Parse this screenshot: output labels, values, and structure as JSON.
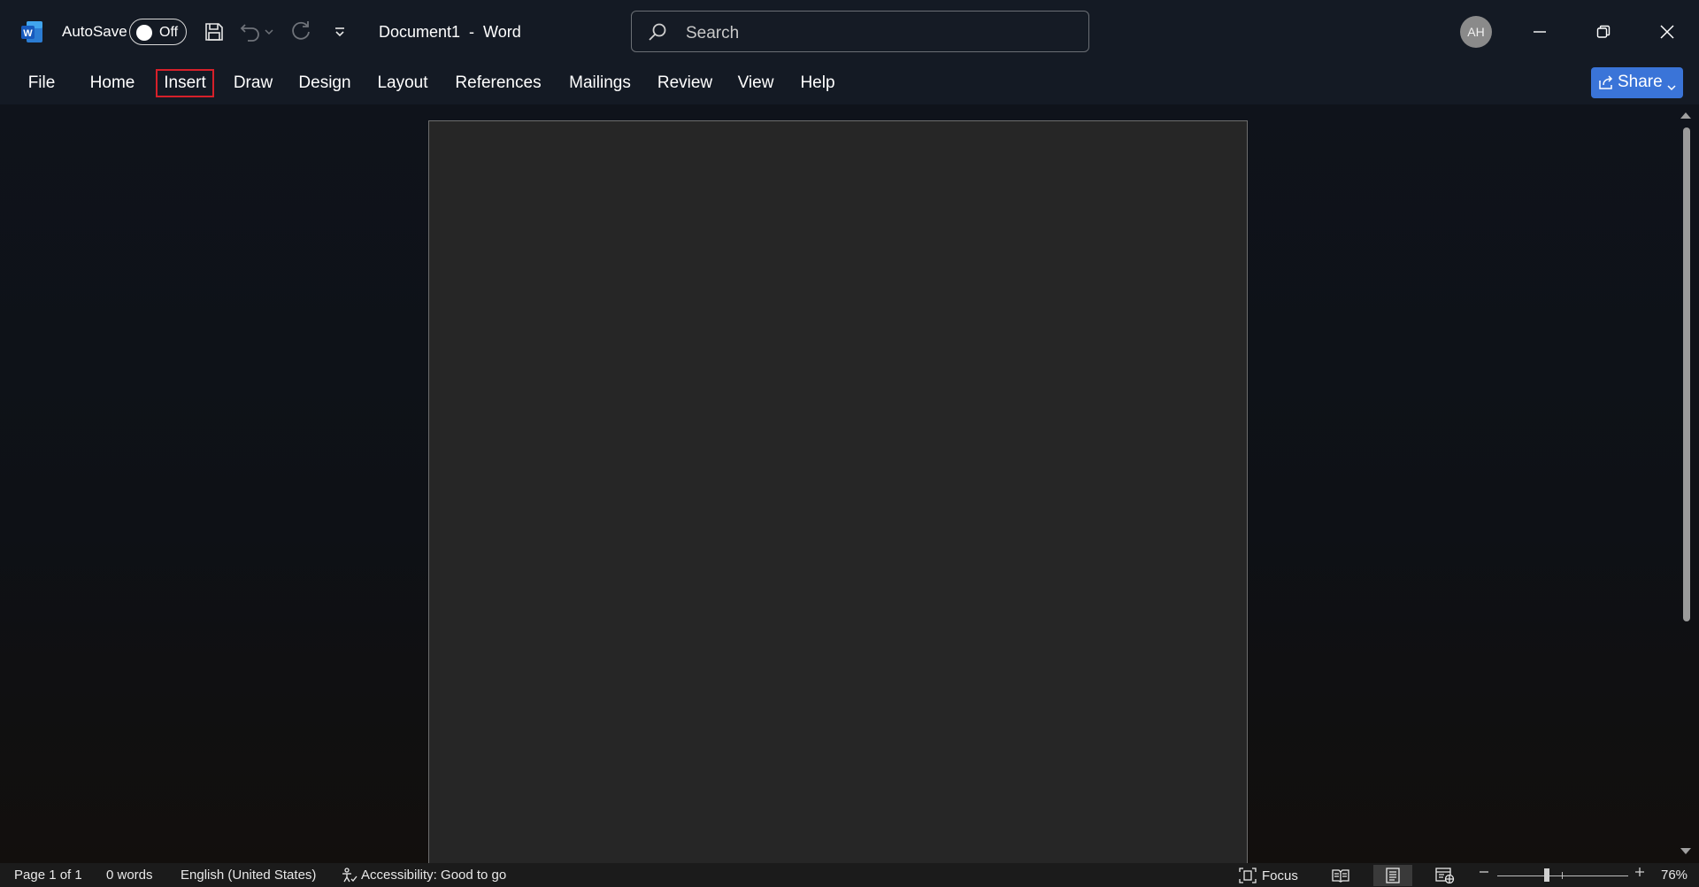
{
  "titlebar": {
    "app_icon": "word-logo-icon",
    "autosave_label": "AutoSave",
    "autosave_state": "Off",
    "document_title": "Document1  -  Word",
    "search_placeholder": "Search",
    "user_initials": "AH"
  },
  "ribbon": {
    "tabs": [
      "File",
      "Home",
      "Insert",
      "Draw",
      "Design",
      "Layout",
      "References",
      "Mailings",
      "Review",
      "View",
      "Help"
    ],
    "selected_tab": "Insert",
    "share_label": "Share",
    "accent_color": "#3a74d8",
    "selection_outline_color": "#d6202a"
  },
  "status": {
    "page": "Page 1 of 1",
    "words": "0 words",
    "language": "English (United States)",
    "accessibility": "Accessibility: Good to go",
    "focus": "Focus",
    "zoom": "76%"
  }
}
